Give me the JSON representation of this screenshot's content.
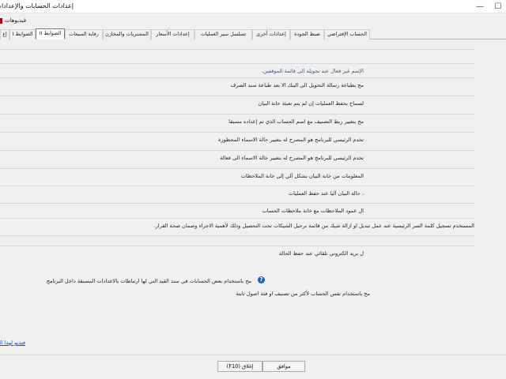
{
  "window": {
    "title": "إعدادات الحسابات والإعدادات",
    "minimize": "—",
    "maximize": "☐"
  },
  "videos_link": "فيديوهات",
  "tabs": [
    {
      "label": "الحساب الإفتراضي"
    },
    {
      "label": "ضبط الجودة"
    },
    {
      "label": "إعدادات أخرى"
    },
    {
      "label": "تسلسل سير العمليات"
    },
    {
      "label": "إعدادات الأسعار"
    },
    {
      "label": "المشتريات والمخازن"
    },
    {
      "label": "رقابة المبيعات"
    },
    {
      "label": "الضوابط II"
    },
    {
      "label": "الضوابط I"
    },
    {
      "label": "إع"
    }
  ],
  "active_tab": "الضوابط II",
  "rows": [
    {
      "text": ""
    },
    {
      "text": "الإسم غير فعال عند تحويله الى قائمة الموقفين.",
      "blue": true
    },
    {
      "text": "مح بطباعة رسالة التحويل الى البنك الا بعد طباعة سند الصرف"
    },
    {
      "text": "لسماح بحفظ العمليات إن لم يتم تعبئة خانة البيان"
    },
    {
      "text": "مح بتغيير ربط التصنيف مع اسم الحساب الذي تم إعداده مسبقا"
    },
    {
      "text": "تخدم الرئيسي للبرنامج هو المصرح له بتغيير حالة الاسماء المحظورة"
    },
    {
      "text": "تخدم الرئيسي للبرنامج هو المصرح له بتغيير حالة الاسماء الى فعالة"
    },
    {
      "text": "المعلومات من خانة البيان بشكل آلي إلى خانة الملاحظات"
    },
    {
      "text": "، حالة البيان آليا عند حفظ العمليات"
    },
    {
      "text": "ال عمود الملاحظات مع خانة ملاحظات الحساب"
    },
    {
      "text": "المستخدم تسجيل كلمة السر الرئيسية عند عمل تبديل او ازالة شيك من قائمة ترحيل الشيكات تحت التحصيل وذلك لأهمية الاجراء وضمان صحة القرار.",
      "wide": true
    },
    {
      "text": ""
    },
    {
      "text": "ل بريد الكتروني تلقائي عند حفظ الحالة"
    }
  ],
  "check_lines": [
    {
      "text": "مح باستخدام بعض الحسابات في سند القيد التي لها ارتباطات بالاعدادات المسبقة داخل البرنامج",
      "help_icon": "question-circle-icon"
    },
    {
      "text": "مح باستخدام نفس الحساب لأكثر من تصنيف او فئة اصول ثابتة"
    }
  ],
  "section_video_link": "فيديو لهذا القسم",
  "buttons": {
    "close": "إغلاق (F10)",
    "ok": "موافق"
  }
}
